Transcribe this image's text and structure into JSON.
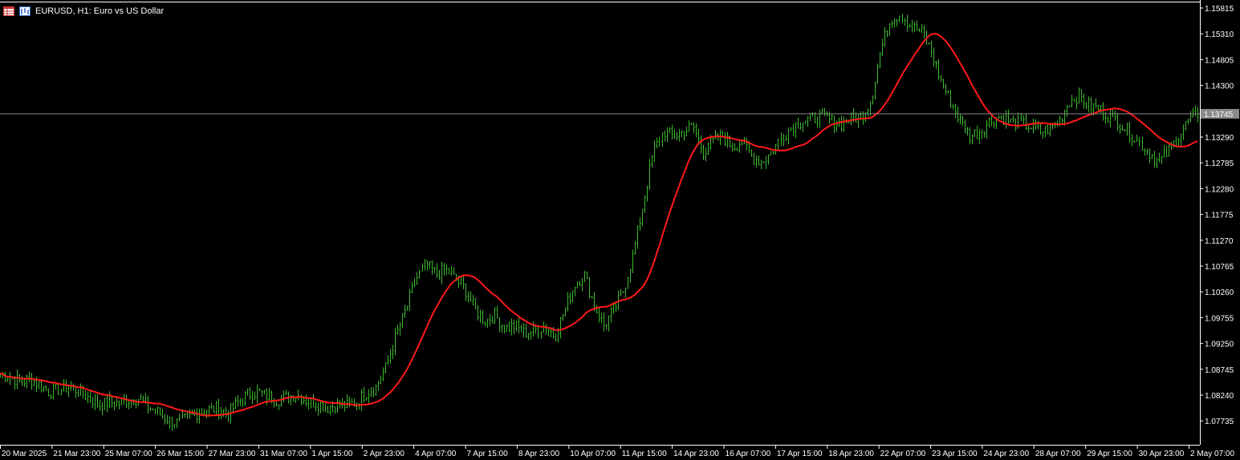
{
  "window": {
    "title": "EURUSD, H1:  Euro vs US Dollar",
    "icons": [
      "chart-table-icon",
      "chart-bars-icon"
    ]
  },
  "colors": {
    "background": "#000000",
    "bars": "#3CB82E",
    "moving_average": "#FF1A1A",
    "axis": "#FFFFFF",
    "bid_line": "#8A8A8A",
    "bid_label_bg": "#8A8A8A"
  },
  "chart_data": {
    "type": "bar",
    "symbol": "EURUSD",
    "timeframe": "H1",
    "description": "Euro vs US Dollar",
    "current_price": "1.13745",
    "price_ticks": [
      "1.15815",
      "1.15310",
      "1.14805",
      "1.14300",
      "1.13795",
      "1.13290",
      "1.12785",
      "1.12280",
      "1.11775",
      "1.11270",
      "1.10765",
      "1.10260",
      "1.09755",
      "1.09250",
      "1.08745",
      "1.08240",
      "1.07735"
    ],
    "time_ticks": [
      "20 Mar 2025",
      "21 Mar 23:00",
      "25 Mar 07:00",
      "26 Mar 15:00",
      "27 Mar 23:00",
      "31 Mar 07:00",
      "1 Apr 15:00",
      "2 Apr 23:00",
      "4 Apr 07:00",
      "7 Apr 15:00",
      "8 Apr 23:00",
      "10 Apr 07:00",
      "11 Apr 15:00",
      "14 Apr 23:00",
      "16 Apr 07:00",
      "17 Apr 15:00",
      "18 Apr 23:00",
      "22 Apr 07:00",
      "23 Apr 15:00",
      "24 Apr 23:00",
      "28 Apr 07:00",
      "29 Apr 15:00",
      "30 Apr 23:00",
      "2 May 07:00"
    ],
    "close_path": [
      1.0866,
      1.086,
      1.085,
      1.0855,
      1.0845,
      1.083,
      1.0835,
      1.084,
      1.083,
      1.0818,
      1.0805,
      1.081,
      1.0808,
      1.0815,
      1.0818,
      1.08,
      1.079,
      1.0775,
      1.077,
      1.078,
      1.079,
      1.0795,
      1.0798,
      1.0788,
      1.081,
      1.0825,
      1.083,
      1.0822,
      1.0815,
      1.082,
      1.0825,
      1.0812,
      1.0808,
      1.08,
      1.0806,
      1.0803,
      1.081,
      1.083,
      1.084,
      1.088,
      1.094,
      1.099,
      1.105,
      1.108,
      1.106,
      1.107,
      1.105,
      1.103,
      1.099,
      1.097,
      1.098,
      1.0955,
      1.096,
      1.0945,
      1.095,
      1.096,
      1.094,
      1.099,
      1.104,
      1.106,
      1.1,
      1.096,
      1.099,
      1.103,
      1.11,
      1.12,
      1.13,
      1.134,
      1.133,
      1.134,
      1.135,
      1.13,
      1.132,
      1.133,
      1.131,
      1.132,
      1.129,
      1.128,
      1.13,
      1.133,
      1.135,
      1.136,
      1.1365,
      1.137,
      1.136,
      1.1355,
      1.1365,
      1.137,
      1.14,
      1.15,
      1.156,
      1.157,
      1.1545,
      1.1535,
      1.15,
      1.144,
      1.14,
      1.136,
      1.133,
      1.134,
      1.136,
      1.137,
      1.136,
      1.1355,
      1.135,
      1.134,
      1.1345,
      1.136,
      1.14,
      1.141,
      1.139,
      1.1385,
      1.137,
      1.136,
      1.134,
      1.132,
      1.13,
      1.128,
      1.13,
      1.133,
      1.136,
      1.1375
    ]
  }
}
